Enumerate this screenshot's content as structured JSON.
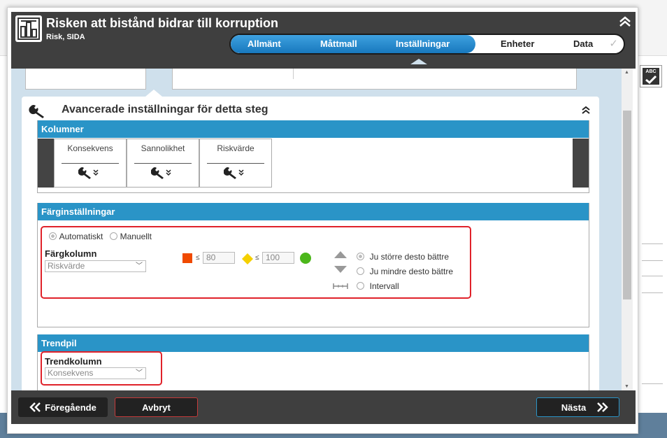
{
  "header": {
    "title": "Risken att bistånd bidrar till korruption",
    "subtitle": "Risk, SIDA",
    "steps": [
      {
        "label": "Allmänt",
        "done": true
      },
      {
        "label": "Måttmall",
        "done": true
      },
      {
        "label": "Inställningar",
        "done": true
      },
      {
        "label": "Enheter",
        "done": false
      },
      {
        "label": "Data",
        "done": false
      }
    ]
  },
  "card": {
    "title": "Avancerade inställningar för detta steg"
  },
  "columns": {
    "heading": "Kolumner",
    "items": [
      "Konsekvens",
      "Sannolikhet",
      "Riskvärde"
    ]
  },
  "color_settings": {
    "heading": "Färginställningar",
    "mode_options": [
      "Automatiskt",
      "Manuellt"
    ],
    "selected_mode": "Automatiskt",
    "color_column_label": "Färgkolumn",
    "color_column_value": "Riskvärde",
    "threshold_symbol": "≤",
    "threshold_1": "80",
    "threshold_2": "100",
    "colors": {
      "low": "#f04a00",
      "mid": "#f5d000",
      "high": "#4cb71b"
    },
    "direction_options": [
      "Ju större desto bättre",
      "Ju mindre desto bättre",
      "Intervall"
    ],
    "selected_direction": "Ju större desto bättre"
  },
  "trend": {
    "heading": "Trendpil",
    "label": "Trendkolumn",
    "value": "Konsekvens"
  },
  "footer": {
    "prev_label": "Föregående",
    "cancel_label": "Avbryt",
    "next_label": "Nästa"
  },
  "accent_color": "#2a94c7",
  "highlight_color": "#e0222a"
}
